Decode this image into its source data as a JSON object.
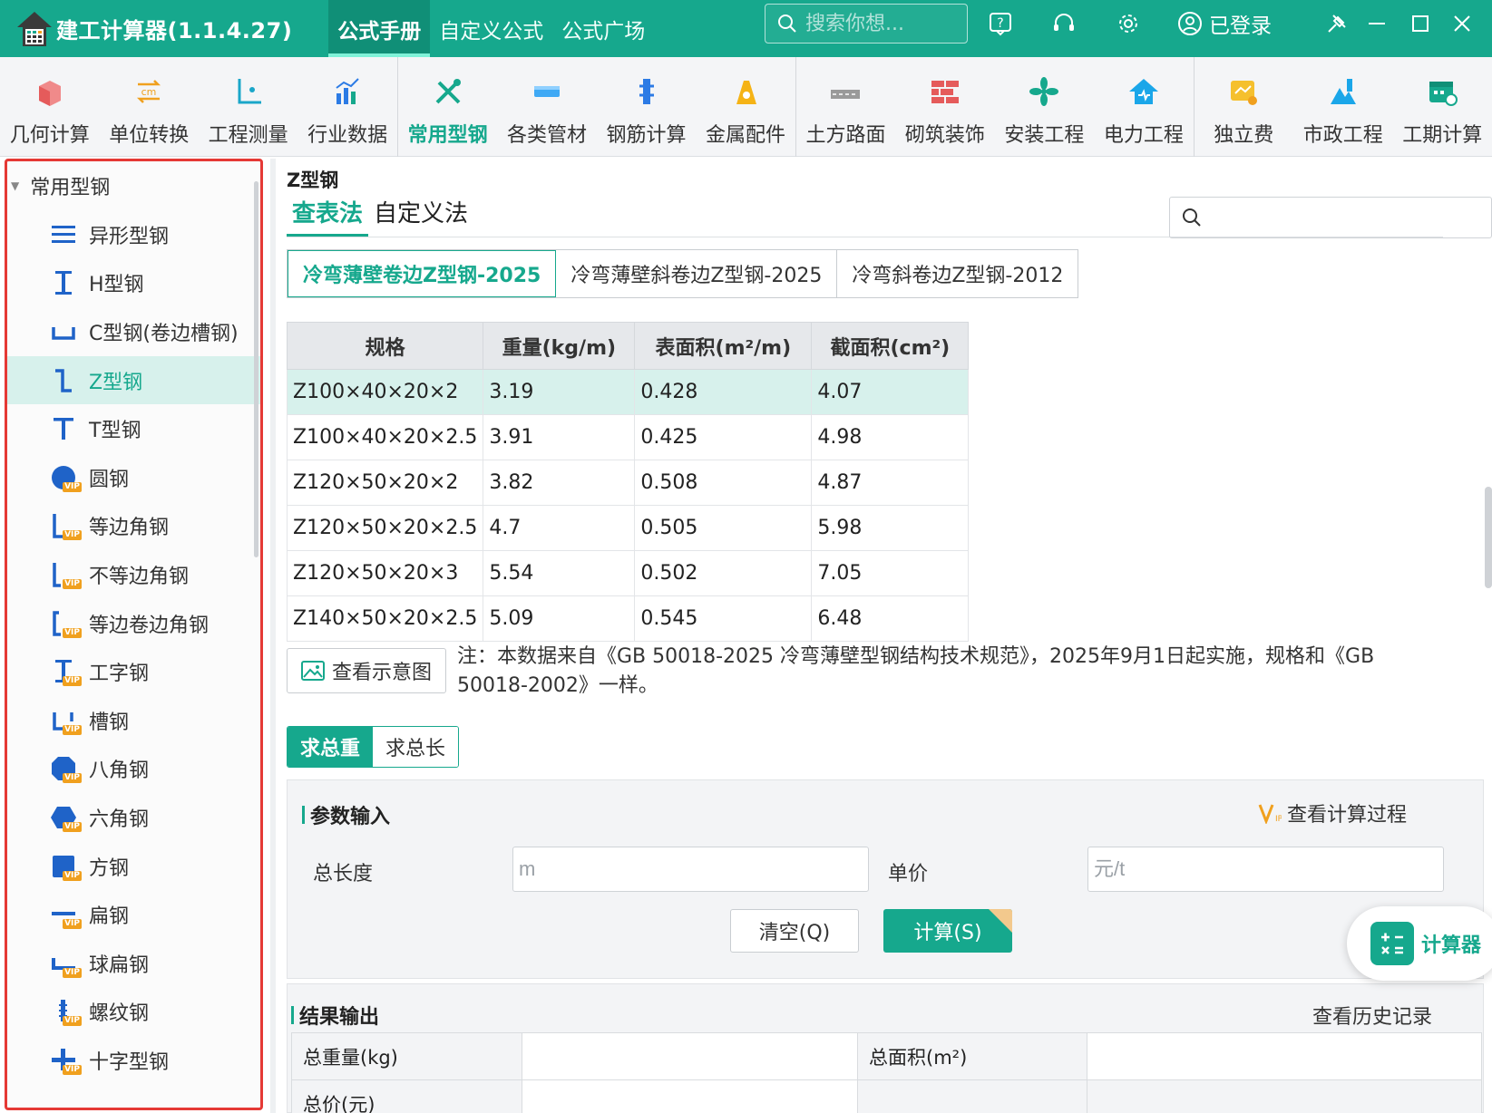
{
  "app": {
    "title": "建工计算器(1.1.4.27)",
    "login_label": "已登录"
  },
  "top_tabs": [
    {
      "label": "公式手册",
      "active": true
    },
    {
      "label": "自定义公式",
      "active": false
    },
    {
      "label": "公式广场",
      "active": false
    }
  ],
  "search": {
    "placeholder": "搜索你想..."
  },
  "ribbon": [
    {
      "label": "几何计算",
      "icon": "cube-icon"
    },
    {
      "label": "单位转换",
      "icon": "unit-convert-icon"
    },
    {
      "label": "工程测量",
      "icon": "measure-icon"
    },
    {
      "label": "行业数据",
      "icon": "industry-data-icon"
    },
    {
      "label": "常用型钢",
      "icon": "tools-icon",
      "active": true
    },
    {
      "label": "各类管材",
      "icon": "pipe-icon"
    },
    {
      "label": "钢筋计算",
      "icon": "rebar-icon"
    },
    {
      "label": "金属配件",
      "icon": "metal-fitting-icon"
    },
    {
      "label": "土方路面",
      "icon": "road-icon"
    },
    {
      "label": "砌筑装饰",
      "icon": "brick-icon"
    },
    {
      "label": "安装工程",
      "icon": "fan-icon"
    },
    {
      "label": "电力工程",
      "icon": "power-house-icon"
    },
    {
      "label": "独立费",
      "icon": "fee-icon"
    },
    {
      "label": "市政工程",
      "icon": "municipal-icon"
    },
    {
      "label": "工期计算",
      "icon": "calendar-icon"
    }
  ],
  "sidebar": {
    "group": "常用型钢",
    "items": [
      {
        "label": "异形型钢",
        "icon": "special-shape-icon",
        "vip": false
      },
      {
        "label": "H型钢",
        "icon": "h-beam-icon",
        "vip": false
      },
      {
        "label": "C型钢(卷边槽钢)",
        "icon": "c-steel-icon",
        "vip": false
      },
      {
        "label": "Z型钢",
        "icon": "z-steel-icon",
        "vip": false,
        "active": true
      },
      {
        "label": "T型钢",
        "icon": "t-steel-icon",
        "vip": false
      },
      {
        "label": "圆钢",
        "icon": "round-steel-icon",
        "vip": true
      },
      {
        "label": "等边角钢",
        "icon": "equal-angle-icon",
        "vip": true
      },
      {
        "label": "不等边角钢",
        "icon": "unequal-angle-icon",
        "vip": true
      },
      {
        "label": "等边卷边角钢",
        "icon": "lipped-angle-icon",
        "vip": true
      },
      {
        "label": "工字钢",
        "icon": "i-beam-icon",
        "vip": true
      },
      {
        "label": "槽钢",
        "icon": "channel-icon",
        "vip": true
      },
      {
        "label": "八角钢",
        "icon": "octagon-steel-icon",
        "vip": true
      },
      {
        "label": "六角钢",
        "icon": "hexagon-steel-icon",
        "vip": true
      },
      {
        "label": "方钢",
        "icon": "square-steel-icon",
        "vip": true
      },
      {
        "label": "扁钢",
        "icon": "flat-steel-icon",
        "vip": true
      },
      {
        "label": "球扁钢",
        "icon": "bulb-flat-icon",
        "vip": true
      },
      {
        "label": "螺纹钢",
        "icon": "rebar-thread-icon",
        "vip": true
      },
      {
        "label": "十字型钢",
        "icon": "cross-steel-icon",
        "vip": true
      }
    ]
  },
  "main": {
    "title": "Z型钢",
    "method_tabs": [
      {
        "label": "查表法",
        "active": true
      },
      {
        "label": "自定义法",
        "active": false
      }
    ],
    "standard_tabs": [
      {
        "label": "冷弯薄壁卷边Z型钢-2025",
        "active": true
      },
      {
        "label": "冷弯薄壁斜卷边Z型钢-2025",
        "active": false
      },
      {
        "label": "冷弯斜卷边Z型钢-2012",
        "active": false
      }
    ],
    "table": {
      "headers": [
        "规格",
        "重量(kg/m)",
        "表面积(m²/m)",
        "截面积(cm²)"
      ],
      "rows": [
        [
          "Z100×40×20×2",
          "3.19",
          "0.428",
          "4.07"
        ],
        [
          "Z100×40×20×2.5",
          "3.91",
          "0.425",
          "4.98"
        ],
        [
          "Z120×50×20×2",
          "3.82",
          "0.508",
          "4.87"
        ],
        [
          "Z120×50×20×2.5",
          "4.7",
          "0.505",
          "5.98"
        ],
        [
          "Z120×50×20×3",
          "5.54",
          "0.502",
          "7.05"
        ],
        [
          "Z140×50×20×2.5",
          "5.09",
          "0.545",
          "6.48"
        ]
      ]
    },
    "diagram_button": "查看示意图",
    "note": "注：本数据来自《GB 50018-2025 冷弯薄壁型钢结构技术规范》，2025年9月1日起实施，规格和《GB 50018-2002》一样。",
    "calc_tabs": [
      {
        "label": "求总重",
        "active": true
      },
      {
        "label": "求总长",
        "active": false
      }
    ],
    "params": {
      "title": "参数输入",
      "view_process": "查看计算过程",
      "length_label": "总长度",
      "length_placeholder": "m",
      "price_label": "单价",
      "price_placeholder": "元/t",
      "clear_button": "清空(Q)",
      "calc_button": "计算(S)"
    },
    "results": {
      "title": "结果输出",
      "history": "查看历史记录",
      "weight_label": "总重量(kg)",
      "area_label": "总面积(m²)",
      "price_label": "总价(元)"
    }
  },
  "floating": {
    "label": "计算器"
  },
  "colors": {
    "brand": "#16a88d",
    "highlight": "#d7f1ec",
    "vip": "#f0a01e",
    "annotation_border": "#e53935"
  }
}
